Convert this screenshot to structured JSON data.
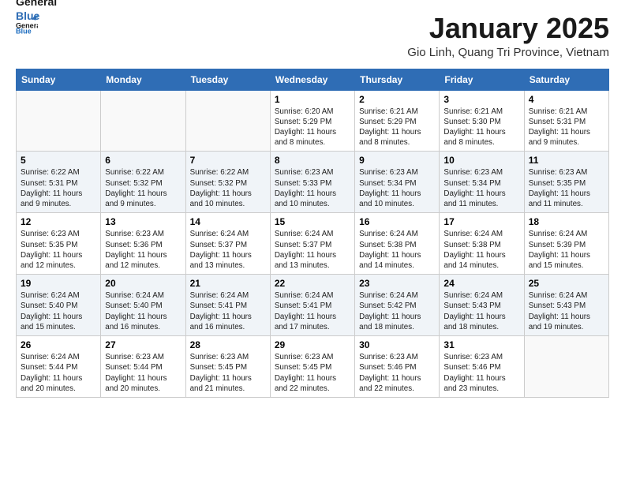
{
  "header": {
    "logo_line1": "General",
    "logo_line2": "Blue",
    "month_title": "January 2025",
    "location": "Gio Linh, Quang Tri Province, Vietnam"
  },
  "weekdays": [
    "Sunday",
    "Monday",
    "Tuesday",
    "Wednesday",
    "Thursday",
    "Friday",
    "Saturday"
  ],
  "weeks": [
    [
      {
        "day": "",
        "sunrise": "",
        "sunset": "",
        "daylight": ""
      },
      {
        "day": "",
        "sunrise": "",
        "sunset": "",
        "daylight": ""
      },
      {
        "day": "",
        "sunrise": "",
        "sunset": "",
        "daylight": ""
      },
      {
        "day": "1",
        "sunrise": "Sunrise: 6:20 AM",
        "sunset": "Sunset: 5:29 PM",
        "daylight": "Daylight: 11 hours and 8 minutes."
      },
      {
        "day": "2",
        "sunrise": "Sunrise: 6:21 AM",
        "sunset": "Sunset: 5:29 PM",
        "daylight": "Daylight: 11 hours and 8 minutes."
      },
      {
        "day": "3",
        "sunrise": "Sunrise: 6:21 AM",
        "sunset": "Sunset: 5:30 PM",
        "daylight": "Daylight: 11 hours and 8 minutes."
      },
      {
        "day": "4",
        "sunrise": "Sunrise: 6:21 AM",
        "sunset": "Sunset: 5:31 PM",
        "daylight": "Daylight: 11 hours and 9 minutes."
      }
    ],
    [
      {
        "day": "5",
        "sunrise": "Sunrise: 6:22 AM",
        "sunset": "Sunset: 5:31 PM",
        "daylight": "Daylight: 11 hours and 9 minutes."
      },
      {
        "day": "6",
        "sunrise": "Sunrise: 6:22 AM",
        "sunset": "Sunset: 5:32 PM",
        "daylight": "Daylight: 11 hours and 9 minutes."
      },
      {
        "day": "7",
        "sunrise": "Sunrise: 6:22 AM",
        "sunset": "Sunset: 5:32 PM",
        "daylight": "Daylight: 11 hours and 10 minutes."
      },
      {
        "day": "8",
        "sunrise": "Sunrise: 6:23 AM",
        "sunset": "Sunset: 5:33 PM",
        "daylight": "Daylight: 11 hours and 10 minutes."
      },
      {
        "day": "9",
        "sunrise": "Sunrise: 6:23 AM",
        "sunset": "Sunset: 5:34 PM",
        "daylight": "Daylight: 11 hours and 10 minutes."
      },
      {
        "day": "10",
        "sunrise": "Sunrise: 6:23 AM",
        "sunset": "Sunset: 5:34 PM",
        "daylight": "Daylight: 11 hours and 11 minutes."
      },
      {
        "day": "11",
        "sunrise": "Sunrise: 6:23 AM",
        "sunset": "Sunset: 5:35 PM",
        "daylight": "Daylight: 11 hours and 11 minutes."
      }
    ],
    [
      {
        "day": "12",
        "sunrise": "Sunrise: 6:23 AM",
        "sunset": "Sunset: 5:35 PM",
        "daylight": "Daylight: 11 hours and 12 minutes."
      },
      {
        "day": "13",
        "sunrise": "Sunrise: 6:23 AM",
        "sunset": "Sunset: 5:36 PM",
        "daylight": "Daylight: 11 hours and 12 minutes."
      },
      {
        "day": "14",
        "sunrise": "Sunrise: 6:24 AM",
        "sunset": "Sunset: 5:37 PM",
        "daylight": "Daylight: 11 hours and 13 minutes."
      },
      {
        "day": "15",
        "sunrise": "Sunrise: 6:24 AM",
        "sunset": "Sunset: 5:37 PM",
        "daylight": "Daylight: 11 hours and 13 minutes."
      },
      {
        "day": "16",
        "sunrise": "Sunrise: 6:24 AM",
        "sunset": "Sunset: 5:38 PM",
        "daylight": "Daylight: 11 hours and 14 minutes."
      },
      {
        "day": "17",
        "sunrise": "Sunrise: 6:24 AM",
        "sunset": "Sunset: 5:38 PM",
        "daylight": "Daylight: 11 hours and 14 minutes."
      },
      {
        "day": "18",
        "sunrise": "Sunrise: 6:24 AM",
        "sunset": "Sunset: 5:39 PM",
        "daylight": "Daylight: 11 hours and 15 minutes."
      }
    ],
    [
      {
        "day": "19",
        "sunrise": "Sunrise: 6:24 AM",
        "sunset": "Sunset: 5:40 PM",
        "daylight": "Daylight: 11 hours and 15 minutes."
      },
      {
        "day": "20",
        "sunrise": "Sunrise: 6:24 AM",
        "sunset": "Sunset: 5:40 PM",
        "daylight": "Daylight: 11 hours and 16 minutes."
      },
      {
        "day": "21",
        "sunrise": "Sunrise: 6:24 AM",
        "sunset": "Sunset: 5:41 PM",
        "daylight": "Daylight: 11 hours and 16 minutes."
      },
      {
        "day": "22",
        "sunrise": "Sunrise: 6:24 AM",
        "sunset": "Sunset: 5:41 PM",
        "daylight": "Daylight: 11 hours and 17 minutes."
      },
      {
        "day": "23",
        "sunrise": "Sunrise: 6:24 AM",
        "sunset": "Sunset: 5:42 PM",
        "daylight": "Daylight: 11 hours and 18 minutes."
      },
      {
        "day": "24",
        "sunrise": "Sunrise: 6:24 AM",
        "sunset": "Sunset: 5:43 PM",
        "daylight": "Daylight: 11 hours and 18 minutes."
      },
      {
        "day": "25",
        "sunrise": "Sunrise: 6:24 AM",
        "sunset": "Sunset: 5:43 PM",
        "daylight": "Daylight: 11 hours and 19 minutes."
      }
    ],
    [
      {
        "day": "26",
        "sunrise": "Sunrise: 6:24 AM",
        "sunset": "Sunset: 5:44 PM",
        "daylight": "Daylight: 11 hours and 20 minutes."
      },
      {
        "day": "27",
        "sunrise": "Sunrise: 6:23 AM",
        "sunset": "Sunset: 5:44 PM",
        "daylight": "Daylight: 11 hours and 20 minutes."
      },
      {
        "day": "28",
        "sunrise": "Sunrise: 6:23 AM",
        "sunset": "Sunset: 5:45 PM",
        "daylight": "Daylight: 11 hours and 21 minutes."
      },
      {
        "day": "29",
        "sunrise": "Sunrise: 6:23 AM",
        "sunset": "Sunset: 5:45 PM",
        "daylight": "Daylight: 11 hours and 22 minutes."
      },
      {
        "day": "30",
        "sunrise": "Sunrise: 6:23 AM",
        "sunset": "Sunset: 5:46 PM",
        "daylight": "Daylight: 11 hours and 22 minutes."
      },
      {
        "day": "31",
        "sunrise": "Sunrise: 6:23 AM",
        "sunset": "Sunset: 5:46 PM",
        "daylight": "Daylight: 11 hours and 23 minutes."
      },
      {
        "day": "",
        "sunrise": "",
        "sunset": "",
        "daylight": ""
      }
    ]
  ]
}
